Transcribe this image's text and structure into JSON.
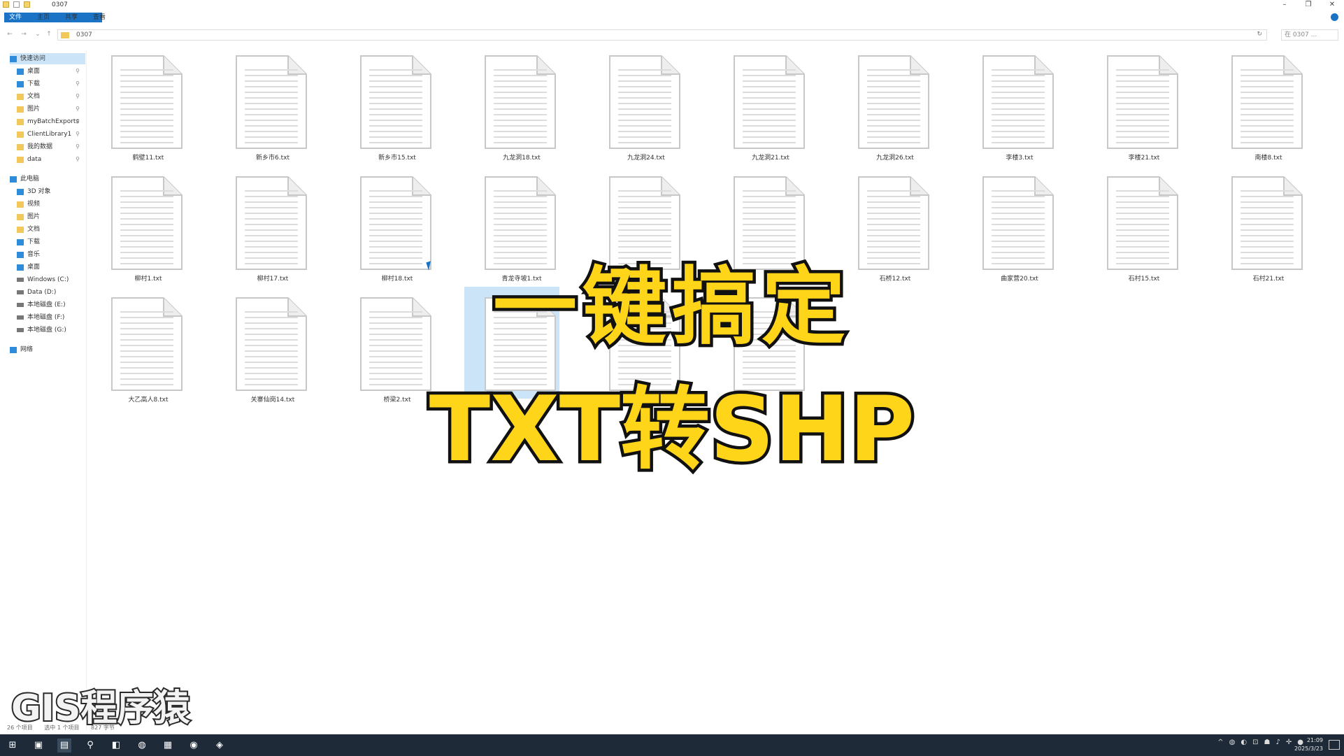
{
  "window": {
    "title": "0307",
    "controls": [
      "–",
      "❐",
      "✕"
    ]
  },
  "ribbon": {
    "tabs": [
      "文件",
      "主页",
      "共享",
      "查看"
    ]
  },
  "address": {
    "path": "0307",
    "search_placeholder": "在 0307 ..."
  },
  "sidebar": {
    "items": [
      {
        "label": "快速访问",
        "icon": "star-icon",
        "selected": true,
        "pinned": false,
        "indent": 0
      },
      {
        "label": "桌面",
        "icon": "desktop-icon",
        "selected": false,
        "pinned": true,
        "indent": 1
      },
      {
        "label": "下载",
        "icon": "download-icon",
        "selected": false,
        "pinned": true,
        "indent": 1
      },
      {
        "label": "文档",
        "icon": "folder-icon",
        "selected": false,
        "pinned": true,
        "indent": 1
      },
      {
        "label": "图片",
        "icon": "folder-icon",
        "selected": false,
        "pinned": true,
        "indent": 1
      },
      {
        "label": "myBatchExports",
        "icon": "folder-icon",
        "selected": false,
        "pinned": true,
        "indent": 1
      },
      {
        "label": "ClientLibrary1",
        "icon": "folder-icon",
        "selected": false,
        "pinned": true,
        "indent": 1
      },
      {
        "label": "我的数据",
        "icon": "folder-icon",
        "selected": false,
        "pinned": true,
        "indent": 1
      },
      {
        "label": "data",
        "icon": "folder-icon",
        "selected": false,
        "pinned": true,
        "indent": 1
      },
      {
        "label": "此电脑",
        "icon": "computer-icon",
        "selected": false,
        "pinned": false,
        "indent": 0
      },
      {
        "label": "3D 对象",
        "icon": "cube-icon",
        "selected": false,
        "pinned": false,
        "indent": 1
      },
      {
        "label": "视频",
        "icon": "video-icon",
        "selected": false,
        "pinned": false,
        "indent": 1
      },
      {
        "label": "图片",
        "icon": "picture-icon",
        "selected": false,
        "pinned": false,
        "indent": 1
      },
      {
        "label": "文档",
        "icon": "document-icon",
        "selected": false,
        "pinned": false,
        "indent": 1
      },
      {
        "label": "下载",
        "icon": "download-icon",
        "selected": false,
        "pinned": false,
        "indent": 1
      },
      {
        "label": "音乐",
        "icon": "music-icon",
        "selected": false,
        "pinned": false,
        "indent": 1
      },
      {
        "label": "桌面",
        "icon": "desktop-icon",
        "selected": false,
        "pinned": false,
        "indent": 1
      },
      {
        "label": "Windows (C:)",
        "icon": "drive-icon",
        "selected": false,
        "pinned": false,
        "indent": 1
      },
      {
        "label": "Data (D:)",
        "icon": "drive-icon",
        "selected": false,
        "pinned": false,
        "indent": 1
      },
      {
        "label": "本地磁盘 (E:)",
        "icon": "drive-icon",
        "selected": false,
        "pinned": false,
        "indent": 1
      },
      {
        "label": "本地磁盘 (F:)",
        "icon": "drive-icon",
        "selected": false,
        "pinned": false,
        "indent": 1
      },
      {
        "label": "本地磁盘 (G:)",
        "icon": "drive-icon",
        "selected": false,
        "pinned": false,
        "indent": 1
      },
      {
        "label": "网络",
        "icon": "network-icon",
        "selected": false,
        "pinned": false,
        "indent": 0
      }
    ]
  },
  "files": [
    {
      "name": "鹤壁11.txt"
    },
    {
      "name": "新乡市6.txt"
    },
    {
      "name": "新乡市15.txt"
    },
    {
      "name": "九龙洞18.txt"
    },
    {
      "name": "九龙洞24.txt"
    },
    {
      "name": "九龙洞21.txt"
    },
    {
      "name": "九龙洞26.txt"
    },
    {
      "name": "李楼3.txt"
    },
    {
      "name": "李楼21.txt"
    },
    {
      "name": "南楼8.txt"
    },
    {
      "name": "柳村1.txt"
    },
    {
      "name": "柳村17.txt"
    },
    {
      "name": "柳村18.txt"
    },
    {
      "name": "青龙寺坡1.txt"
    },
    {
      "name": ""
    },
    {
      "name": ""
    },
    {
      "name": "石桥12.txt"
    },
    {
      "name": "曲家营20.txt"
    },
    {
      "name": "石村15.txt"
    },
    {
      "name": "石村21.txt"
    },
    {
      "name": "大乙高人8.txt"
    },
    {
      "name": "关寨仙岗14.txt"
    },
    {
      "name": "桥梁2.txt"
    },
    {
      "name": "",
      "highlight": true
    },
    {
      "name": ""
    },
    {
      "name": ""
    }
  ],
  "overlay": {
    "title": "一键搞定",
    "subtitle": "TXT转SHP",
    "watermark": "GIS程序猿"
  },
  "status": {
    "count": "26 个项目",
    "selection": "选中 1 个项目",
    "size": "827 字节"
  },
  "taskbar": {
    "buttons": [
      {
        "name": "start-button",
        "glyph": "⊞"
      },
      {
        "name": "task-view-button",
        "glyph": "▣"
      },
      {
        "name": "file-explorer-taskbar-button",
        "glyph": "▤",
        "active": true
      },
      {
        "name": "search-taskbar-button",
        "glyph": "⚲"
      },
      {
        "name": "app-taskbar-button",
        "glyph": "◧"
      },
      {
        "name": "wechat-taskbar-button",
        "glyph": "◍"
      },
      {
        "name": "app2-taskbar-button",
        "glyph": "▦"
      },
      {
        "name": "chrome-taskbar-button",
        "glyph": "◉"
      },
      {
        "name": "app3-taskbar-button",
        "glyph": "◈"
      }
    ],
    "tray": [
      "^",
      "◍",
      "◐",
      "⊡",
      "☗",
      "♪",
      "✛",
      "●"
    ],
    "time": "21:09",
    "date": "2025/3/23"
  },
  "colors": {
    "accent": "#1a73c4",
    "caption_fill": "#ffd51a",
    "caption_stroke": "#111111",
    "taskbar": "#1e2a38"
  }
}
